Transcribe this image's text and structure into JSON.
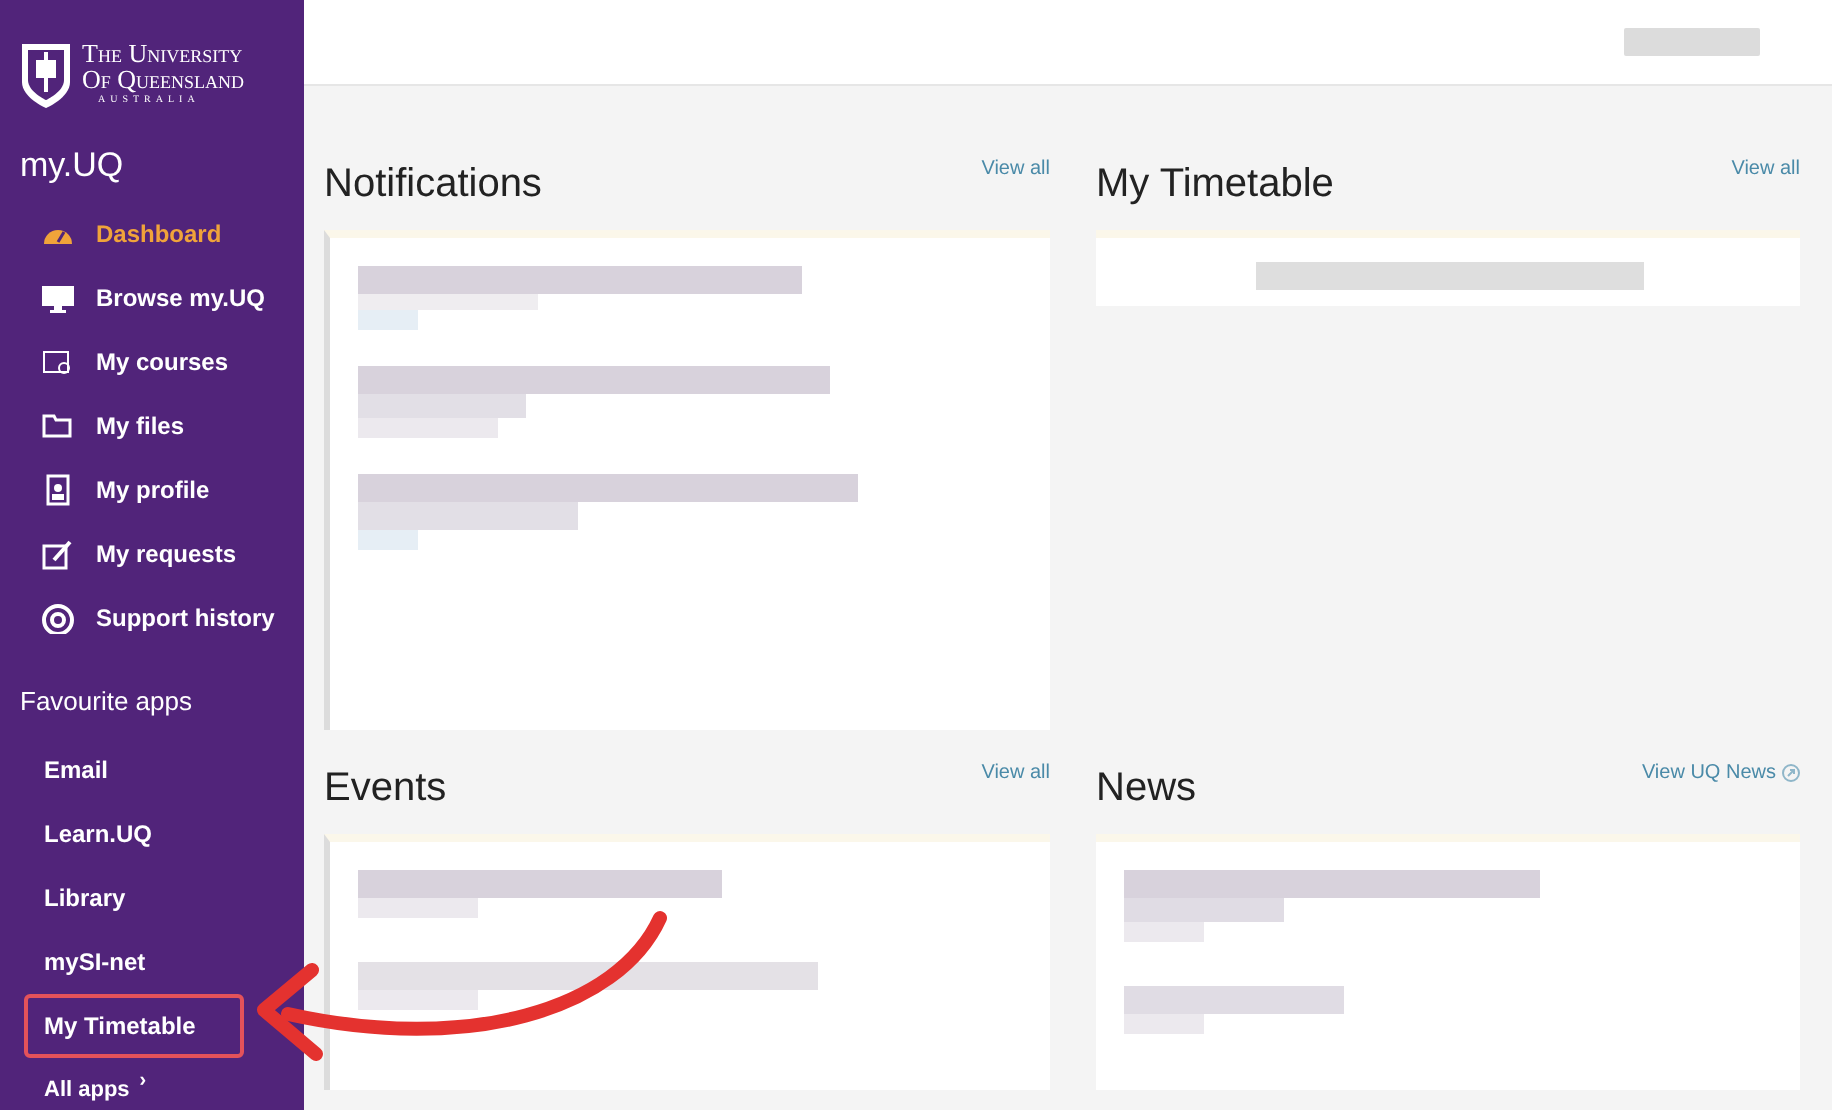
{
  "sidebar": {
    "logo": {
      "lines": [
        "The University",
        "Of Queensland",
        "AUSTRALIA"
      ]
    },
    "title": "my.UQ",
    "items": [
      {
        "label": "Dashboard",
        "selected": true
      },
      {
        "label": "Browse my.UQ",
        "selected": false
      },
      {
        "label": "My courses",
        "selected": false
      },
      {
        "label": "My files",
        "selected": false
      },
      {
        "label": "My profile",
        "selected": false
      },
      {
        "label": "My requests",
        "selected": false
      },
      {
        "label": "Support history",
        "selected": false
      }
    ],
    "favourites_heading": "Favourite apps",
    "favourites": [
      {
        "label": "Email",
        "highlighted": false
      },
      {
        "label": "Learn.UQ",
        "highlighted": false
      },
      {
        "label": "Library",
        "highlighted": false
      },
      {
        "label": "mySI-net",
        "highlighted": false
      },
      {
        "label": "My Timetable",
        "highlighted": true
      }
    ],
    "all_apps": "All apps",
    "all_apps_caret": "›"
  },
  "panels": [
    {
      "title": "Notifications",
      "link": "View all",
      "external": false
    },
    {
      "title": "My Timetable",
      "link": "View all",
      "external": false
    },
    {
      "title": "Events",
      "link": "View all",
      "external": false
    },
    {
      "title": "News",
      "link": "View UQ News",
      "external": true
    }
  ]
}
